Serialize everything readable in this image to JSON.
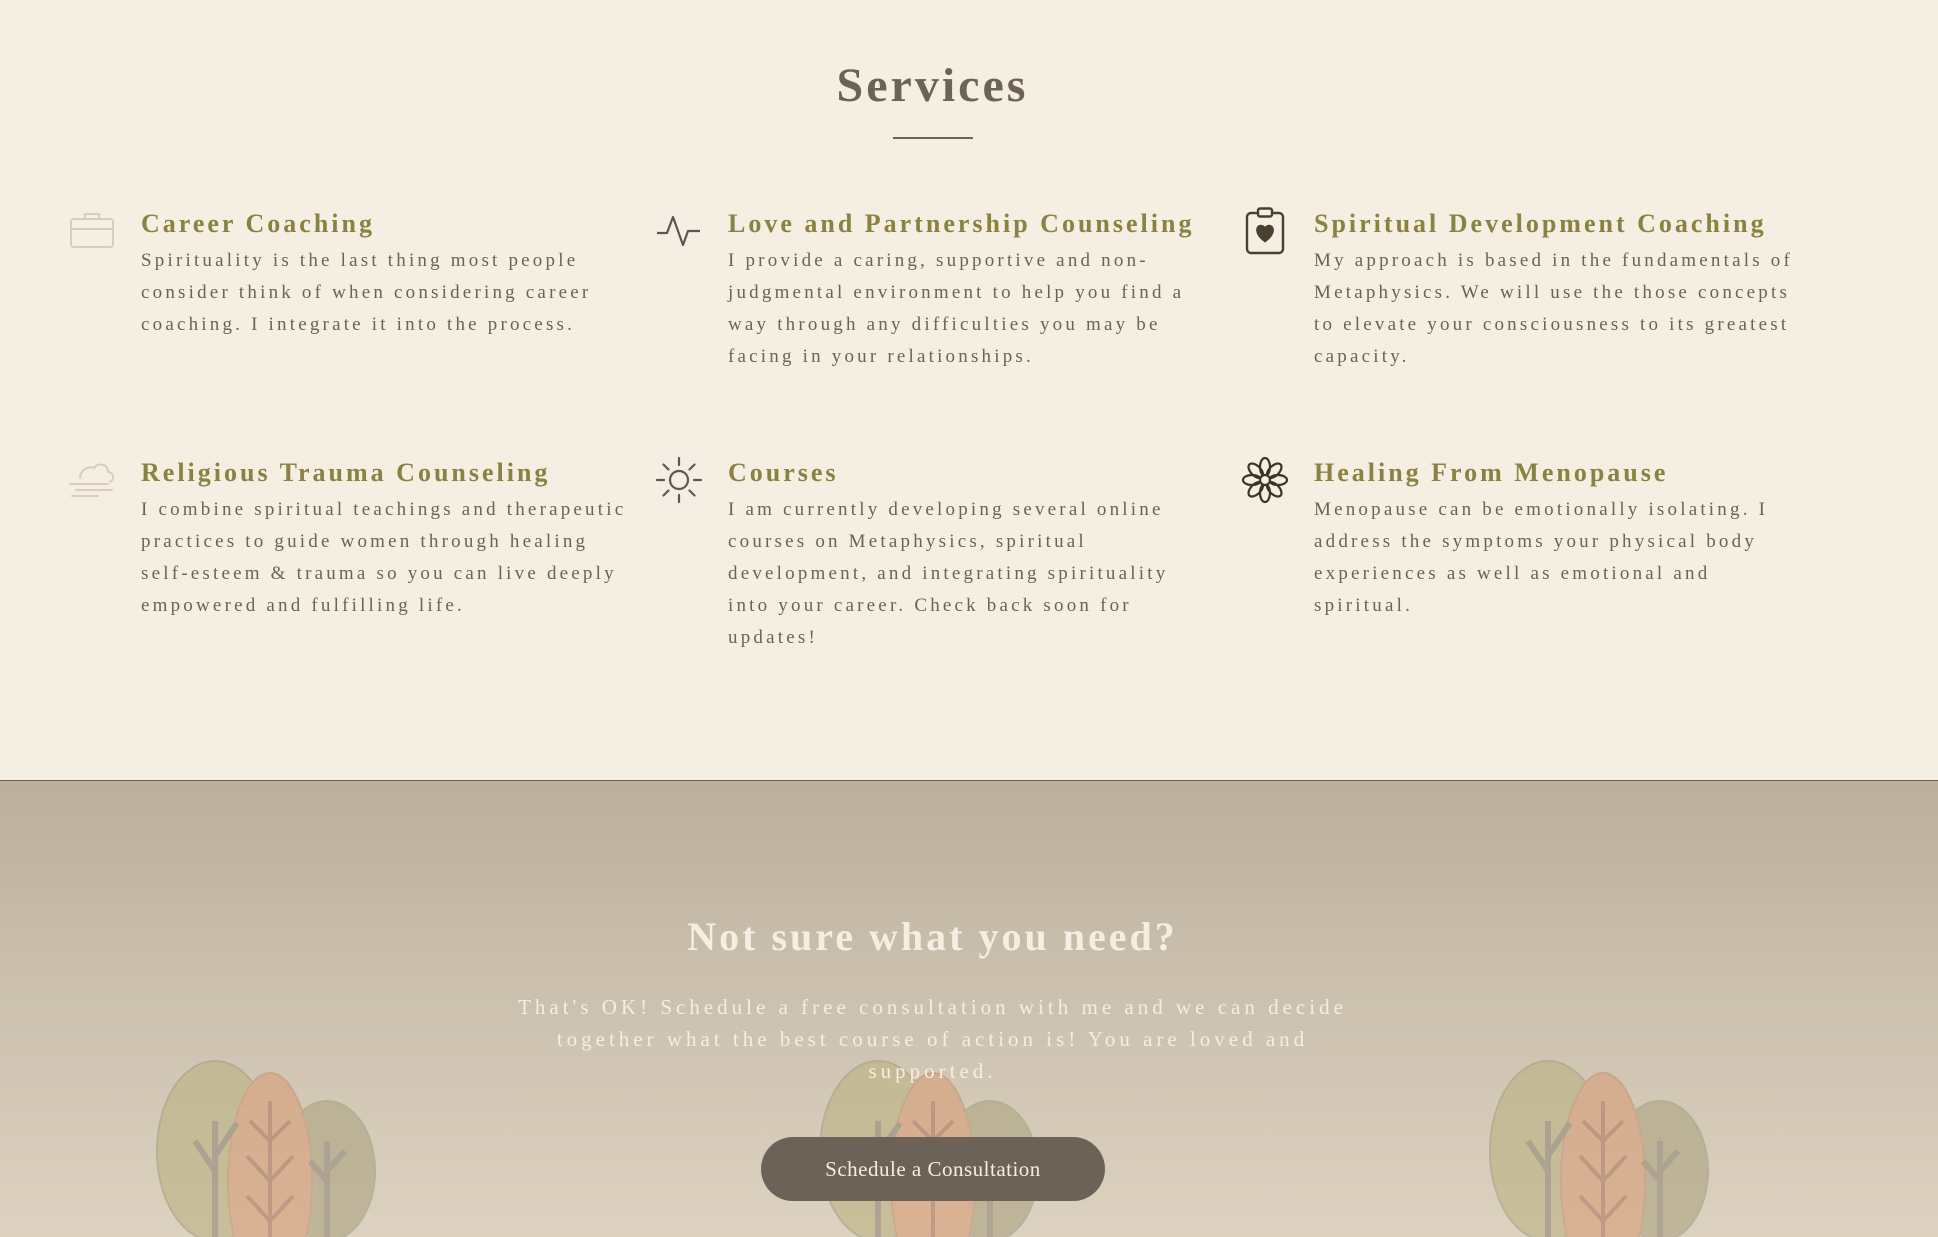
{
  "services": {
    "title": "Services",
    "items": [
      {
        "icon": "briefcase-icon",
        "title": "Career Coaching",
        "description": "Spirituality is the last thing most people consider think of when considering career coaching. I integrate it into the process."
      },
      {
        "icon": "pulse-icon",
        "title": "Love and Partnership Counseling",
        "description": "I provide a caring, supportive and non-judgmental environment to help you find a way through any difficulties you may be facing in your relationships."
      },
      {
        "icon": "clipboard-heart-icon",
        "title": "Spiritual Development Coaching",
        "description": "My approach is based in the fundamentals of Metaphysics. We will use the those concepts to elevate your consciousness to its greatest capacity."
      },
      {
        "icon": "wind-cloud-icon",
        "title": "Religious Trauma Counseling",
        "description": "I combine spiritual teachings and therapeutic practices to guide women through healing self-esteem & trauma so you can live deeply empowered and fulfilling life."
      },
      {
        "icon": "sun-icon",
        "title": "Courses",
        "description": "I am currently developing several online courses on Metaphysics, spiritual development, and integrating spirituality into your career. Check back soon for updates!"
      },
      {
        "icon": "flower-icon",
        "title": "Healing From Menopause",
        "description": "Menopause can be emotionally isolating. I address the symptoms your physical body experiences as well as emotional and spiritual."
      }
    ]
  },
  "cta": {
    "heading": "Not sure what you need?",
    "text": "That's OK! Schedule a free consultation with me and we can decide together what the best course of action is! You are loved and supported.",
    "button_label": "Schedule a Consultation"
  },
  "colors": {
    "background": "#f5eee2",
    "accent": "#8a8240",
    "text": "#6d6257",
    "cta_background": "#bcb09c",
    "button": "#6d6257"
  }
}
